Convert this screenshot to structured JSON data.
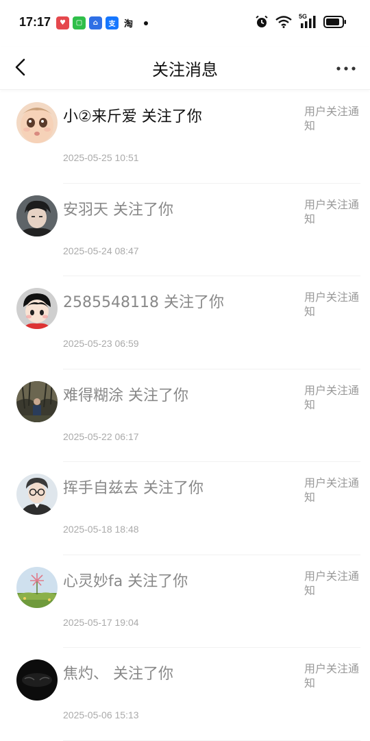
{
  "status_bar": {
    "time": "17:17",
    "apps": [
      {
        "name": "app-1",
        "color": "#e5484d",
        "glyph": "♥"
      },
      {
        "name": "app-2",
        "color": "#2fbf4a",
        "glyph": "▢"
      },
      {
        "name": "app-3",
        "color": "#2f6fe5",
        "glyph": "⌂"
      },
      {
        "name": "alipay",
        "color": "#1677ff",
        "glyph": "支"
      },
      {
        "name": "taobao",
        "color": "#ffffff",
        "glyph": "淘"
      }
    ],
    "network": "5G"
  },
  "nav": {
    "title": "关注消息"
  },
  "notifications": [
    {
      "user": "小②来斤爱",
      "action": "关注了你",
      "type": "用户关注通知",
      "time": "2025-05-25 10:51",
      "unread": true
    },
    {
      "user": "安羽天",
      "action": "关注了你",
      "type": "用户关注通知",
      "time": "2025-05-24 08:47",
      "unread": false
    },
    {
      "user": "2585548118",
      "action": "关注了你",
      "type": "用户关注通知",
      "time": "2025-05-23 06:59",
      "unread": false
    },
    {
      "user": "难得糊涂",
      "action": "关注了你",
      "type": "用户关注通知",
      "time": "2025-05-22 06:17",
      "unread": false
    },
    {
      "user": "挥手自兹去",
      "action": "关注了你",
      "type": "用户关注通知",
      "time": "2025-05-18 18:48",
      "unread": false
    },
    {
      "user": "心灵妙fa",
      "action": "关注了你",
      "type": "用户关注通知",
      "time": "2025-05-17 19:04",
      "unread": false
    },
    {
      "user": "焦灼、",
      "action": "关注了你",
      "type": "用户关注通知",
      "time": "2025-05-06 15:13",
      "unread": false
    }
  ],
  "colors": {
    "unread_text": "#111111",
    "read_text": "#888888",
    "meta_text": "#999999",
    "time_text": "#aaaaaa"
  }
}
